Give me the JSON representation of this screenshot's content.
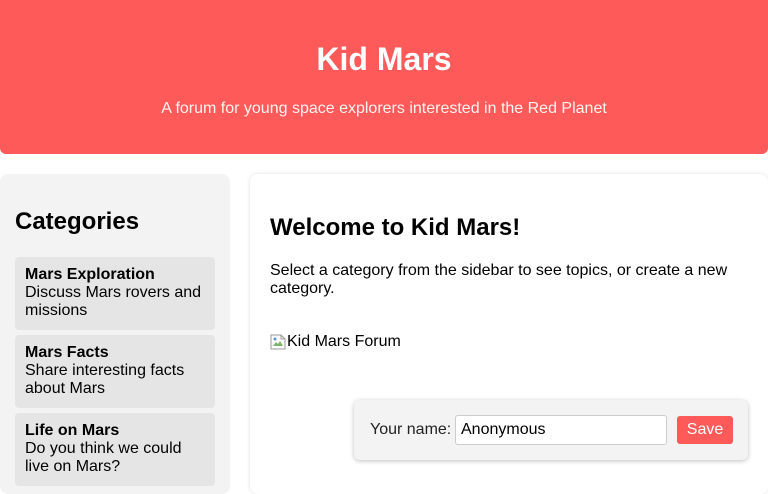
{
  "header": {
    "title": "Kid Mars",
    "subtitle": "A forum for young space explorers interested in the Red Planet"
  },
  "sidebar": {
    "title": "Categories",
    "categories": [
      {
        "name": "Mars Exploration",
        "description": "Discuss Mars rovers and missions"
      },
      {
        "name": "Mars Facts",
        "description": "Share interesting facts about Mars"
      },
      {
        "name": "Life on Mars",
        "description": "Do you think we could live on Mars?"
      }
    ]
  },
  "main": {
    "title": "Welcome to Kid Mars!",
    "intro": "Select a category from the sidebar to see topics, or create a new category.",
    "image_alt": "Kid Mars Forum"
  },
  "user": {
    "name_label": "Your name:",
    "name_value": "Anonymous",
    "save_label": "Save"
  },
  "colors": {
    "accent": "#ff5a5a",
    "sidebar_bg": "#f3f3f3",
    "category_bg": "#e5e5e5"
  },
  "icons": {
    "image_placeholder": "broken-image-icon"
  }
}
